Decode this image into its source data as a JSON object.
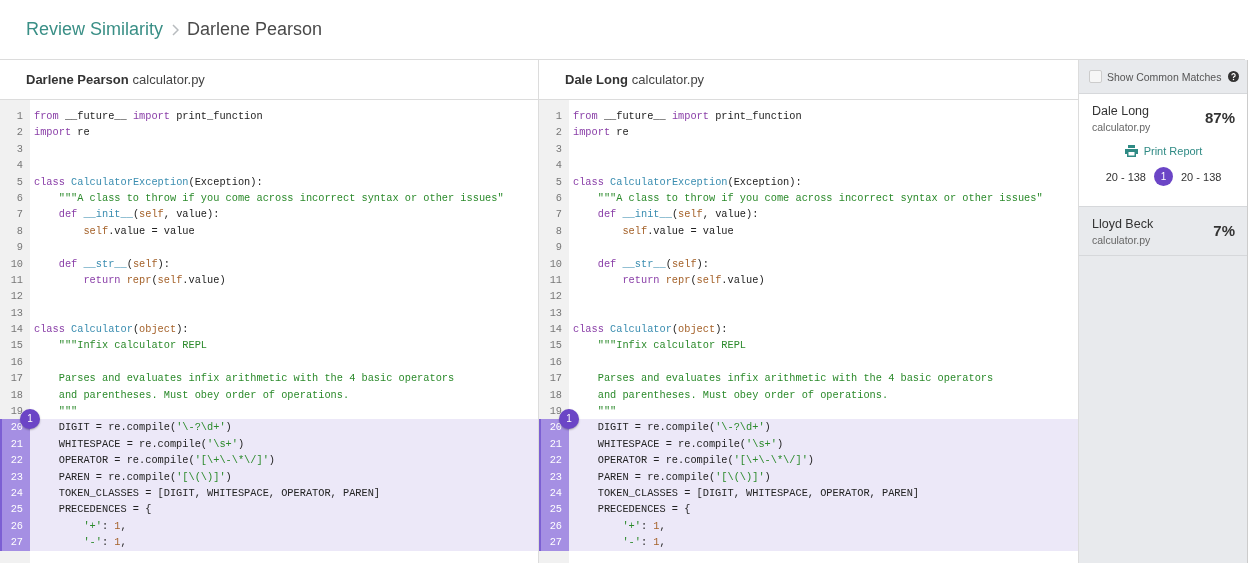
{
  "breadcrumb": {
    "parent": "Review Similarity",
    "current": "Darlene Pearson"
  },
  "panes": [
    {
      "student": "Darlene Pearson",
      "file": "calculator.py",
      "lines": [
        {
          "number": "1",
          "matched": false,
          "tokens": [
            {
              "kind": "kw",
              "text": "from"
            },
            {
              "kind": "p",
              "text": " __future__ "
            },
            {
              "kind": "kw",
              "text": "import"
            },
            {
              "kind": "p",
              "text": " print_function"
            }
          ]
        },
        {
          "number": "2",
          "matched": false,
          "tokens": [
            {
              "kind": "kw",
              "text": "import"
            },
            {
              "kind": "p",
              "text": " re"
            }
          ]
        },
        {
          "number": "3",
          "matched": false
        },
        {
          "number": "4",
          "matched": false
        },
        {
          "number": "5",
          "matched": false,
          "tokens": [
            {
              "kind": "kw",
              "text": "class"
            },
            {
              "kind": "cls",
              "text": " CalculatorException"
            },
            {
              "kind": "p",
              "text": "(Exception):"
            }
          ]
        },
        {
          "number": "6",
          "matched": false,
          "tokens": [
            {
              "kind": "str",
              "text": "    \"\"\"A class to throw if you come across incorrect syntax or other issues\""
            }
          ]
        },
        {
          "number": "7",
          "matched": false,
          "tokens": [
            {
              "kind": "kw",
              "text": "    def"
            },
            {
              "kind": "cls",
              "text": " __init__"
            },
            {
              "kind": "p",
              "text": "("
            },
            {
              "kind": "self",
              "text": "self"
            },
            {
              "kind": "p",
              "text": ", value):"
            }
          ]
        },
        {
          "number": "8",
          "matched": false,
          "tokens": [
            {
              "kind": "self",
              "text": "        self"
            },
            {
              "kind": "p",
              "text": ".value = value"
            }
          ]
        },
        {
          "number": "9",
          "matched": false
        },
        {
          "number": "10",
          "matched": false,
          "tokens": [
            {
              "kind": "kw",
              "text": "    def"
            },
            {
              "kind": "cls",
              "text": " __str__"
            },
            {
              "kind": "p",
              "text": "("
            },
            {
              "kind": "self",
              "text": "self"
            },
            {
              "kind": "p",
              "text": "):"
            }
          ]
        },
        {
          "number": "11",
          "matched": false,
          "tokens": [
            {
              "kind": "kw",
              "text": "        return"
            },
            {
              "kind": "self",
              "text": " repr"
            },
            {
              "kind": "p",
              "text": "("
            },
            {
              "kind": "self",
              "text": "self"
            },
            {
              "kind": "p",
              "text": ".value)"
            }
          ]
        },
        {
          "number": "12",
          "matched": false
        },
        {
          "number": "13",
          "matched": false
        },
        {
          "number": "14",
          "matched": false,
          "tokens": [
            {
              "kind": "kw",
              "text": "class"
            },
            {
              "kind": "cls",
              "text": " Calculator"
            },
            {
              "kind": "p",
              "text": "("
            },
            {
              "kind": "self",
              "text": "object"
            },
            {
              "kind": "p",
              "text": "):"
            }
          ]
        },
        {
          "number": "15",
          "matched": false,
          "tokens": [
            {
              "kind": "str",
              "text": "    \"\"\"Infix calculator REPL"
            }
          ]
        },
        {
          "number": "16",
          "matched": false
        },
        {
          "number": "17",
          "matched": false,
          "tokens": [
            {
              "kind": "str",
              "text": "    Parses and evaluates infix arithmetic with the 4 basic operators"
            }
          ]
        },
        {
          "number": "18",
          "matched": false,
          "tokens": [
            {
              "kind": "str",
              "text": "    and parentheses. Must obey order of operations."
            }
          ]
        },
        {
          "number": "19",
          "matched": false,
          "tokens": [
            {
              "kind": "str",
              "text": "    \"\"\""
            }
          ]
        },
        {
          "number": "20",
          "matched": true,
          "badge": "1",
          "tokens": [
            {
              "kind": "p",
              "text": "    DIGIT = re.compile("
            },
            {
              "kind": "str",
              "text": "'\\-?\\d+'"
            },
            {
              "kind": "p",
              "text": ")"
            }
          ]
        },
        {
          "number": "21",
          "matched": true,
          "tokens": [
            {
              "kind": "p",
              "text": "    WHITESPACE = re.compile("
            },
            {
              "kind": "str",
              "text": "'\\s+'"
            },
            {
              "kind": "p",
              "text": ")"
            }
          ]
        },
        {
          "number": "22",
          "matched": true,
          "tokens": [
            {
              "kind": "p",
              "text": "    OPERATOR = re.compile("
            },
            {
              "kind": "str",
              "text": "'[\\+\\-\\*\\/]'"
            },
            {
              "kind": "p",
              "text": ")"
            }
          ]
        },
        {
          "number": "23",
          "matched": true,
          "tokens": [
            {
              "kind": "p",
              "text": "    PAREN = re.compile("
            },
            {
              "kind": "str",
              "text": "'[\\(\\)]'"
            },
            {
              "kind": "p",
              "text": ")"
            }
          ]
        },
        {
          "number": "24",
          "matched": true,
          "tokens": [
            {
              "kind": "p",
              "text": "    TOKEN_CLASSES = [DIGIT, WHITESPACE, OPERATOR, PAREN]"
            }
          ]
        },
        {
          "number": "25",
          "matched": true,
          "tokens": [
            {
              "kind": "p",
              "text": "    PRECEDENCES = {"
            }
          ]
        },
        {
          "number": "26",
          "matched": true,
          "tokens": [
            {
              "kind": "str",
              "text": "        '+'"
            },
            {
              "kind": "p",
              "text": ": "
            },
            {
              "kind": "num",
              "text": "1"
            },
            {
              "kind": "p",
              "text": ","
            }
          ]
        },
        {
          "number": "27",
          "matched": true,
          "tokens": [
            {
              "kind": "str",
              "text": "        '-'"
            },
            {
              "kind": "p",
              "text": ": "
            },
            {
              "kind": "num",
              "text": "1"
            },
            {
              "kind": "p",
              "text": ","
            }
          ]
        }
      ]
    },
    {
      "student": "Dale Long",
      "file": "calculator.py",
      "lines": [
        {
          "number": "1",
          "matched": false,
          "tokens": [
            {
              "kind": "kw",
              "text": "from"
            },
            {
              "kind": "p",
              "text": " __future__ "
            },
            {
              "kind": "kw",
              "text": "import"
            },
            {
              "kind": "p",
              "text": " print_function"
            }
          ]
        },
        {
          "number": "2",
          "matched": false,
          "tokens": [
            {
              "kind": "kw",
              "text": "import"
            },
            {
              "kind": "p",
              "text": " re"
            }
          ]
        },
        {
          "number": "3",
          "matched": false
        },
        {
          "number": "4",
          "matched": false
        },
        {
          "number": "5",
          "matched": false,
          "tokens": [
            {
              "kind": "kw",
              "text": "class"
            },
            {
              "kind": "cls",
              "text": " CalculatorException"
            },
            {
              "kind": "p",
              "text": "(Exception):"
            }
          ]
        },
        {
          "number": "6",
          "matched": false,
          "tokens": [
            {
              "kind": "str",
              "text": "    \"\"\"A class to throw if you come across incorrect syntax or other issues\""
            }
          ]
        },
        {
          "number": "7",
          "matched": false,
          "tokens": [
            {
              "kind": "kw",
              "text": "    def"
            },
            {
              "kind": "cls",
              "text": " __init__"
            },
            {
              "kind": "p",
              "text": "("
            },
            {
              "kind": "self",
              "text": "self"
            },
            {
              "kind": "p",
              "text": ", value):"
            }
          ]
        },
        {
          "number": "8",
          "matched": false,
          "tokens": [
            {
              "kind": "self",
              "text": "        self"
            },
            {
              "kind": "p",
              "text": ".value = value"
            }
          ]
        },
        {
          "number": "9",
          "matched": false
        },
        {
          "number": "10",
          "matched": false,
          "tokens": [
            {
              "kind": "kw",
              "text": "    def"
            },
            {
              "kind": "cls",
              "text": " __str__"
            },
            {
              "kind": "p",
              "text": "("
            },
            {
              "kind": "self",
              "text": "self"
            },
            {
              "kind": "p",
              "text": "):"
            }
          ]
        },
        {
          "number": "11",
          "matched": false,
          "tokens": [
            {
              "kind": "kw",
              "text": "        return"
            },
            {
              "kind": "self",
              "text": " repr"
            },
            {
              "kind": "p",
              "text": "("
            },
            {
              "kind": "self",
              "text": "self"
            },
            {
              "kind": "p",
              "text": ".value)"
            }
          ]
        },
        {
          "number": "12",
          "matched": false
        },
        {
          "number": "13",
          "matched": false
        },
        {
          "number": "14",
          "matched": false,
          "tokens": [
            {
              "kind": "kw",
              "text": "class"
            },
            {
              "kind": "cls",
              "text": " Calculator"
            },
            {
              "kind": "p",
              "text": "("
            },
            {
              "kind": "self",
              "text": "object"
            },
            {
              "kind": "p",
              "text": "):"
            }
          ]
        },
        {
          "number": "15",
          "matched": false,
          "tokens": [
            {
              "kind": "str",
              "text": "    \"\"\"Infix calculator REPL"
            }
          ]
        },
        {
          "number": "16",
          "matched": false
        },
        {
          "number": "17",
          "matched": false,
          "tokens": [
            {
              "kind": "str",
              "text": "    Parses and evaluates infix arithmetic with the 4 basic operators"
            }
          ]
        },
        {
          "number": "18",
          "matched": false,
          "tokens": [
            {
              "kind": "str",
              "text": "    and parentheses. Must obey order of operations."
            }
          ]
        },
        {
          "number": "19",
          "matched": false,
          "tokens": [
            {
              "kind": "str",
              "text": "    \"\"\""
            }
          ]
        },
        {
          "number": "20",
          "matched": true,
          "badge": "1",
          "tokens": [
            {
              "kind": "p",
              "text": "    DIGIT = re.compile("
            },
            {
              "kind": "str",
              "text": "'\\-?\\d+'"
            },
            {
              "kind": "p",
              "text": ")"
            }
          ]
        },
        {
          "number": "21",
          "matched": true,
          "tokens": [
            {
              "kind": "p",
              "text": "    WHITESPACE = re.compile("
            },
            {
              "kind": "str",
              "text": "'\\s+'"
            },
            {
              "kind": "p",
              "text": ")"
            }
          ]
        },
        {
          "number": "22",
          "matched": true,
          "tokens": [
            {
              "kind": "p",
              "text": "    OPERATOR = re.compile("
            },
            {
              "kind": "str",
              "text": "'[\\+\\-\\*\\/]'"
            },
            {
              "kind": "p",
              "text": ")"
            }
          ]
        },
        {
          "number": "23",
          "matched": true,
          "tokens": [
            {
              "kind": "p",
              "text": "    PAREN = re.compile("
            },
            {
              "kind": "str",
              "text": "'[\\(\\)]'"
            },
            {
              "kind": "p",
              "text": ")"
            }
          ]
        },
        {
          "number": "24",
          "matched": true,
          "tokens": [
            {
              "kind": "p",
              "text": "    TOKEN_CLASSES = [DIGIT, WHITESPACE, OPERATOR, PAREN]"
            }
          ]
        },
        {
          "number": "25",
          "matched": true,
          "tokens": [
            {
              "kind": "p",
              "text": "    PRECEDENCES = {"
            }
          ]
        },
        {
          "number": "26",
          "matched": true,
          "tokens": [
            {
              "kind": "str",
              "text": "        '+'"
            },
            {
              "kind": "p",
              "text": ": "
            },
            {
              "kind": "num",
              "text": "1"
            },
            {
              "kind": "p",
              "text": ","
            }
          ]
        },
        {
          "number": "27",
          "matched": true,
          "tokens": [
            {
              "kind": "str",
              "text": "        '-'"
            },
            {
              "kind": "p",
              "text": ": "
            },
            {
              "kind": "num",
              "text": "1"
            },
            {
              "kind": "p",
              "text": ","
            }
          ]
        }
      ]
    }
  ],
  "sidebar": {
    "show_common": {
      "label": "Show Common Matches",
      "checked": false
    },
    "matches": [
      {
        "student": "Dale Long",
        "file": "calculator.py",
        "percent": "87%",
        "selected": true,
        "print_label": "Print Report",
        "range_left": "20 - 138",
        "badge": "1",
        "range_right": "20 - 138"
      },
      {
        "student": "Lloyd Beck",
        "file": "calculator.py",
        "percent": "7%",
        "selected": false
      }
    ]
  }
}
